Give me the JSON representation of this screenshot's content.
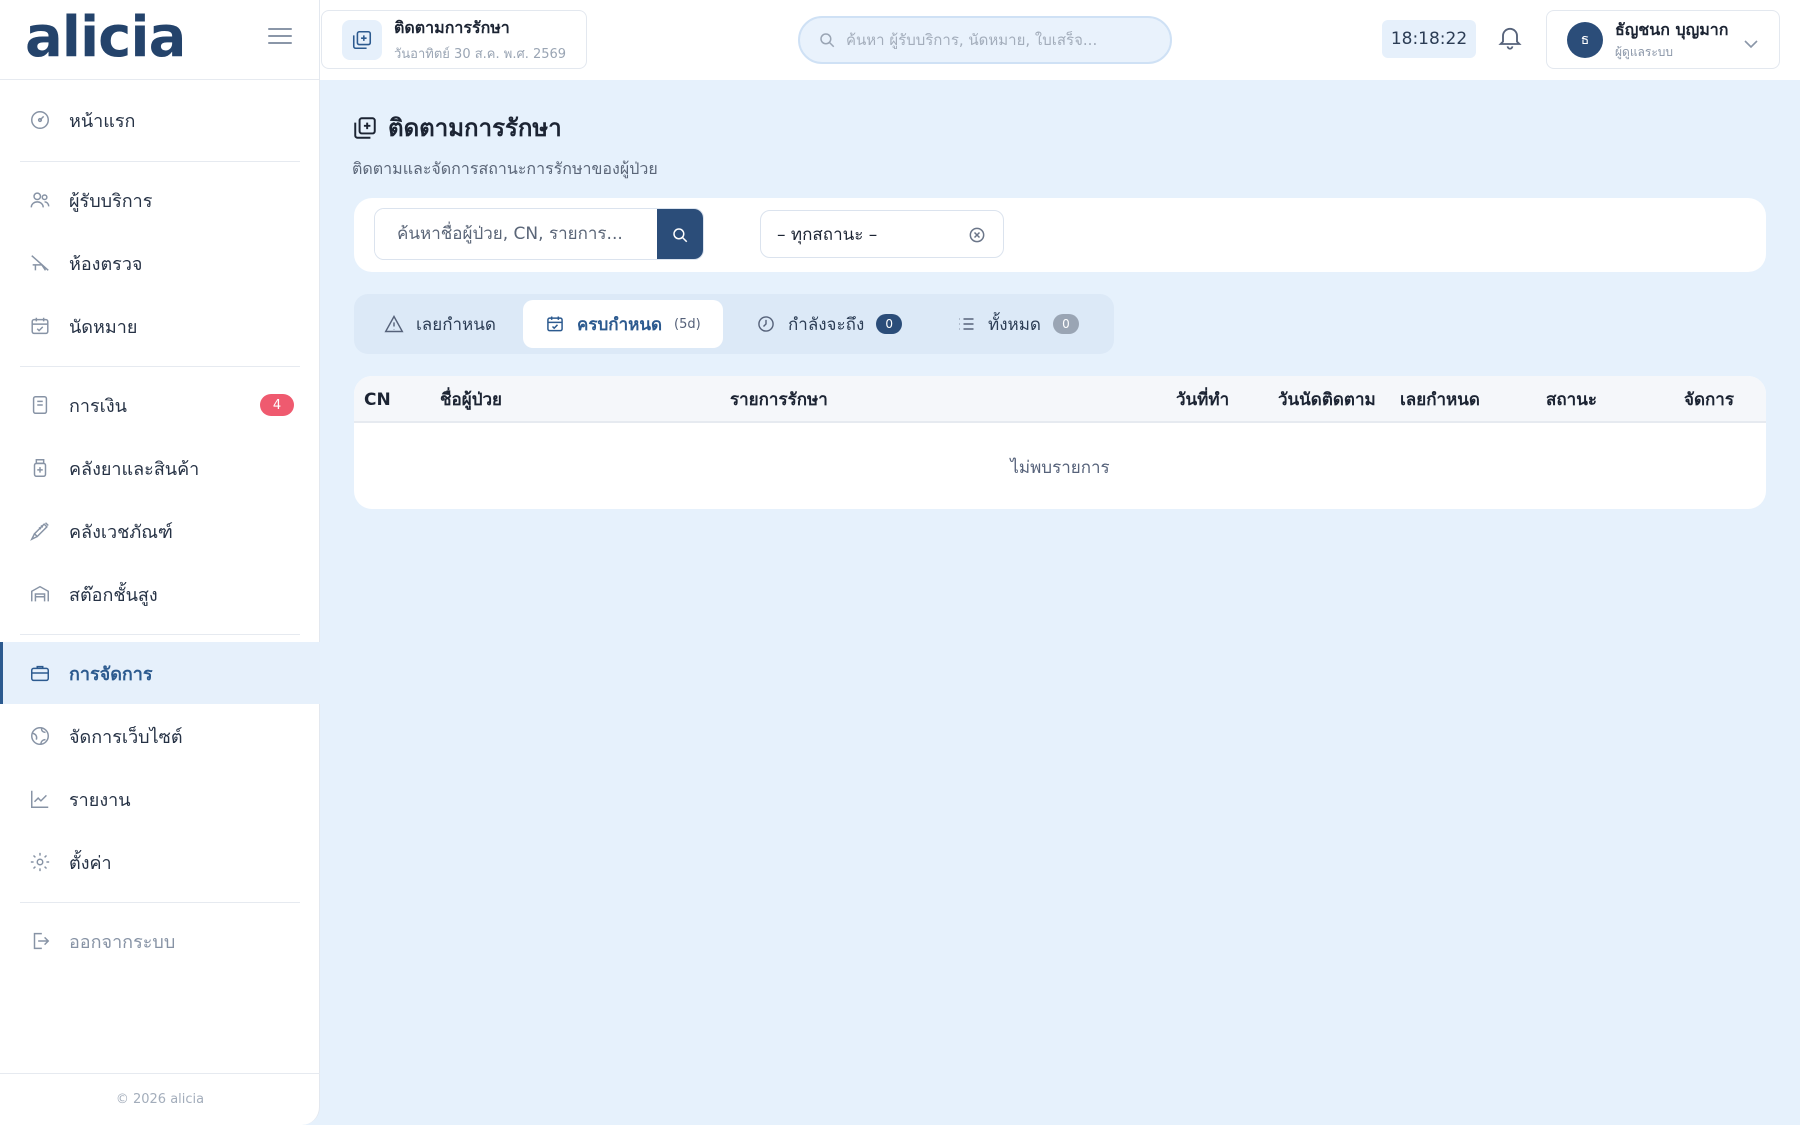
{
  "brand": {
    "logo": "alicia"
  },
  "topbar": {
    "page_chip_title": "ติดตามการรักษา",
    "page_chip_date": "วันอาทิตย์ 30 ส.ค. พ.ศ. 2569",
    "search_placeholder": "ค้นหา ผู้รับบริการ, นัดหมาย, ใบเสร็จ...",
    "clock": "18:18:22",
    "user_initial": "ธ",
    "user_name": "ธัญชนก บุญมาก",
    "user_role": "ผู้ดูแลระบบ"
  },
  "sidebar": {
    "items": [
      {
        "label": "หน้าแรก",
        "icon": "dashboard-icon"
      },
      {
        "label": "ผู้รับบริการ",
        "icon": "users-icon"
      },
      {
        "label": "ห้องตรวจ",
        "icon": "exam-room-icon"
      },
      {
        "label": "นัดหมาย",
        "icon": "calendar-icon"
      },
      {
        "label": "การเงิน",
        "icon": "receipt-icon",
        "badge": "4"
      },
      {
        "label": "คลังยาและสินค้า",
        "icon": "medicine-bottle-icon"
      },
      {
        "label": "คลังเวชภัณฑ์",
        "icon": "syringe-icon"
      },
      {
        "label": "สต๊อกชั้นสูง",
        "icon": "warehouse-icon"
      },
      {
        "label": "การจัดการ",
        "icon": "briefcase-icon",
        "active": true
      },
      {
        "label": "จัดการเว็บไซต์",
        "icon": "globe-icon"
      },
      {
        "label": "รายงาน",
        "icon": "chart-icon"
      },
      {
        "label": "ตั้งค่า",
        "icon": "gear-icon"
      },
      {
        "label": "ออกจากระบบ",
        "icon": "logout-icon"
      }
    ],
    "footer": "© 2026 alicia"
  },
  "page": {
    "title": "ติดตามการรักษา",
    "subtitle": "ติดตามและจัดการสถานะการรักษาของผู้ป่วย"
  },
  "filters": {
    "search_placeholder": "ค้นหาชื่อผู้ป่วย, CN, รายการ...",
    "status_value": "– ทุกสถานะ –"
  },
  "tabs": [
    {
      "label": "เลยกำหนด",
      "icon": "warning-icon"
    },
    {
      "label": "ครบกำหนด",
      "icon": "calendar-check-icon",
      "extra": "(5d)",
      "active": true
    },
    {
      "label": "กำลังจะถึง",
      "icon": "clock-icon",
      "count": "0"
    },
    {
      "label": "ทั้งหมด",
      "icon": "list-icon",
      "count": "0"
    }
  ],
  "table": {
    "columns": [
      "CN",
      "ชื่อผู้ป่วย",
      "รายการรักษา",
      "วันที่ทำ",
      "วันนัดติดตาม",
      "เลยกำหนด",
      "สถานะ",
      "จัดการ"
    ],
    "empty_text": "ไม่พบรายการ"
  },
  "colors": {
    "primary": "#2b4d79",
    "accent": "#2c5a8f",
    "background": "#e6f1fc",
    "badge": "#ef5a6f"
  }
}
